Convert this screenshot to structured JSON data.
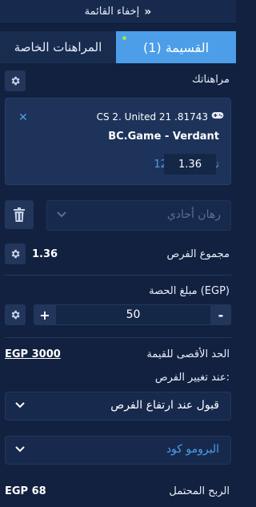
{
  "header": {
    "hide_label": "إخفاء القائمة",
    "chevron": "»"
  },
  "tabs": [
    {
      "label": "المراهنات الخاصة"
    },
    {
      "label": "القسيمة (1)"
    }
  ],
  "my_bets": {
    "label": "مراهناتك"
  },
  "bet_card": {
    "event": "CS 2. United 21 .81743",
    "market": "BC.Game - Verdant",
    "selection": "1تعادل2: فوز2",
    "odds": "1.36"
  },
  "bet_type": {
    "placeholder": "رهان أحادي"
  },
  "total_odds": {
    "label": "مجموع الفرص",
    "value": "1.36"
  },
  "stake": {
    "label": "مبلغ الحصة (EGP)",
    "value": "50",
    "plus": "+",
    "minus": "-"
  },
  "max_value": {
    "label": "الحد الأقصى للقيمة",
    "value": "EGP 3000"
  },
  "odds_change": {
    "label": "عند تغيير الفرص:",
    "selected": "قبول عند ارتفاع الفرص"
  },
  "promo": {
    "label": "البرومو كود"
  },
  "potential_win": {
    "label": "الربح المحتمل",
    "value": "EGP 68"
  },
  "colors": {
    "accent": "#4c9ee8",
    "background": "#12213f",
    "panel": "#1d3359"
  },
  "icons": [
    "gear-icon",
    "close-icon",
    "gamepad-icon",
    "trash-icon",
    "chevron-down-icon"
  ]
}
